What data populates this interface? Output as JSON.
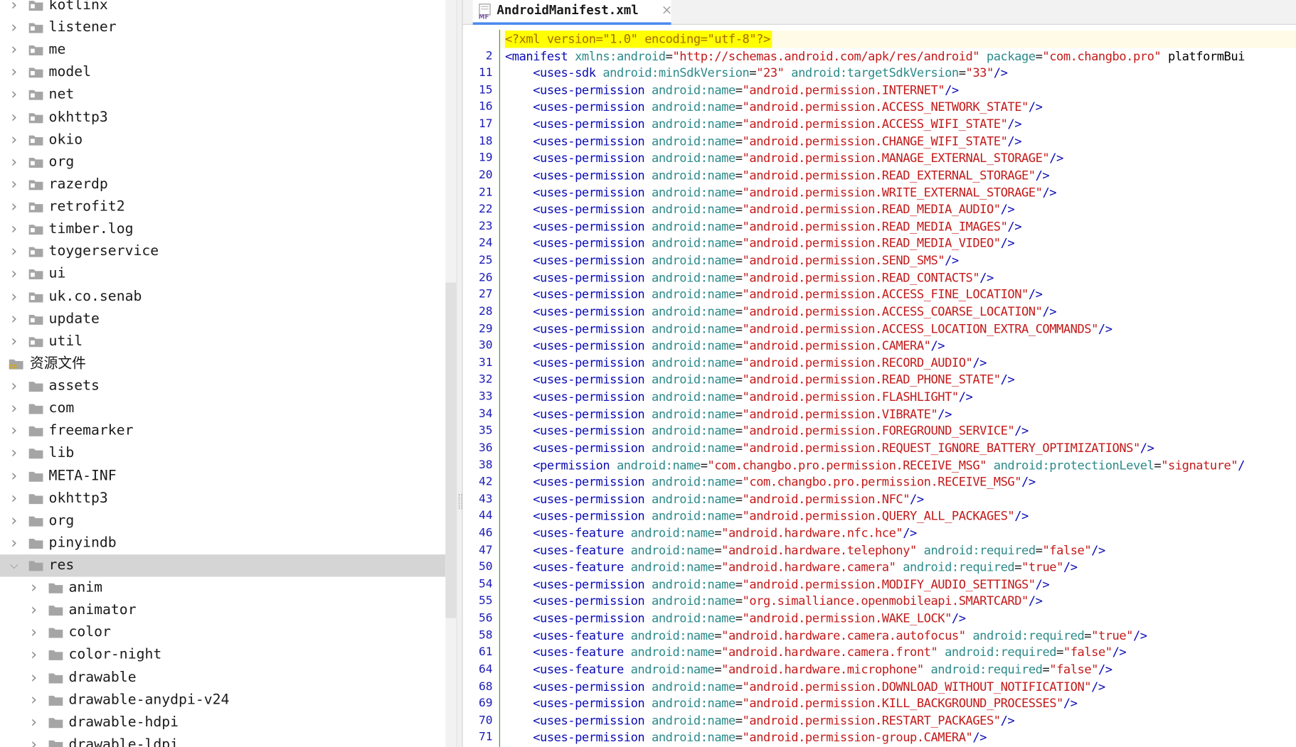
{
  "project_tree": {
    "rows": [
      {
        "label": "kotlinx",
        "indent": 0,
        "chevron": ">",
        "icon": "package-folder-icon"
      },
      {
        "label": "listener",
        "indent": 0,
        "chevron": ">",
        "icon": "package-folder-icon"
      },
      {
        "label": "me",
        "indent": 0,
        "chevron": ">",
        "icon": "package-folder-icon"
      },
      {
        "label": "model",
        "indent": 0,
        "chevron": ">",
        "icon": "package-folder-icon"
      },
      {
        "label": "net",
        "indent": 0,
        "chevron": ">",
        "icon": "package-folder-icon"
      },
      {
        "label": "okhttp3",
        "indent": 0,
        "chevron": ">",
        "icon": "package-folder-icon"
      },
      {
        "label": "okio",
        "indent": 0,
        "chevron": ">",
        "icon": "package-folder-icon"
      },
      {
        "label": "org",
        "indent": 0,
        "chevron": ">",
        "icon": "package-folder-icon"
      },
      {
        "label": "razerdp",
        "indent": 0,
        "chevron": ">",
        "icon": "package-folder-icon"
      },
      {
        "label": "retrofit2",
        "indent": 0,
        "chevron": ">",
        "icon": "package-folder-icon"
      },
      {
        "label": "timber.log",
        "indent": 0,
        "chevron": ">",
        "icon": "package-folder-icon"
      },
      {
        "label": "toygerservice",
        "indent": 0,
        "chevron": ">",
        "icon": "package-folder-icon"
      },
      {
        "label": "ui",
        "indent": 0,
        "chevron": ">",
        "icon": "package-folder-icon"
      },
      {
        "label": "uk.co.senab",
        "indent": 0,
        "chevron": ">",
        "icon": "package-folder-icon"
      },
      {
        "label": "update",
        "indent": 0,
        "chevron": ">",
        "icon": "package-folder-icon"
      },
      {
        "label": "util",
        "indent": 0,
        "chevron": ">",
        "icon": "package-folder-icon"
      },
      {
        "label": "资源文件",
        "indent": -1,
        "chevron": "",
        "icon": "resources-root-icon"
      },
      {
        "label": "assets",
        "indent": 0,
        "chevron": ">",
        "icon": "folder-icon"
      },
      {
        "label": "com",
        "indent": 0,
        "chevron": ">",
        "icon": "folder-icon"
      },
      {
        "label": "freemarker",
        "indent": 0,
        "chevron": ">",
        "icon": "folder-icon"
      },
      {
        "label": "lib",
        "indent": 0,
        "chevron": ">",
        "icon": "folder-icon"
      },
      {
        "label": "META-INF",
        "indent": 0,
        "chevron": ">",
        "icon": "folder-icon"
      },
      {
        "label": "okhttp3",
        "indent": 0,
        "chevron": ">",
        "icon": "folder-icon"
      },
      {
        "label": "org",
        "indent": 0,
        "chevron": ">",
        "icon": "folder-icon"
      },
      {
        "label": "pinyindb",
        "indent": 0,
        "chevron": ">",
        "icon": "folder-icon"
      },
      {
        "label": "res",
        "indent": 0,
        "chevron": "v",
        "icon": "folder-icon",
        "selected": true
      },
      {
        "label": "anim",
        "indent": 1,
        "chevron": ">",
        "icon": "folder-icon"
      },
      {
        "label": "animator",
        "indent": 1,
        "chevron": ">",
        "icon": "folder-icon"
      },
      {
        "label": "color",
        "indent": 1,
        "chevron": ">",
        "icon": "folder-icon"
      },
      {
        "label": "color-night",
        "indent": 1,
        "chevron": ">",
        "icon": "folder-icon"
      },
      {
        "label": "drawable",
        "indent": 1,
        "chevron": ">",
        "icon": "folder-icon"
      },
      {
        "label": "drawable-anydpi-v24",
        "indent": 1,
        "chevron": ">",
        "icon": "folder-icon"
      },
      {
        "label": "drawable-hdpi",
        "indent": 1,
        "chevron": ">",
        "icon": "folder-icon"
      },
      {
        "label": "drawable-ldpi",
        "indent": 1,
        "chevron": ">",
        "icon": "folder-icon"
      }
    ]
  },
  "editor": {
    "tab": {
      "label": "AndroidManifest.xml",
      "close": "×",
      "icon": "manifest-file-icon",
      "icon_text": "MF"
    },
    "colors": {
      "tag": "#0a0ab4",
      "attr": "#2c8a8a",
      "string": "#c41a1a",
      "line_number": "#1c1cb8",
      "highlight": "#ffff00"
    },
    "lines": [
      {
        "num": "",
        "text": "<?xml version=\"1.0\" encoding=\"utf-8\"?>"
      },
      {
        "num": "2",
        "text": "<manifest xmlns:android=\"http://schemas.android.com/apk/res/android\" package=\"com.changbo.pro\" platformBui"
      },
      {
        "num": "11",
        "text": "    <uses-sdk android:minSdkVersion=\"23\" android:targetSdkVersion=\"33\"/>"
      },
      {
        "num": "15",
        "text": "    <uses-permission android:name=\"android.permission.INTERNET\"/>"
      },
      {
        "num": "16",
        "text": "    <uses-permission android:name=\"android.permission.ACCESS_NETWORK_STATE\"/>"
      },
      {
        "num": "17",
        "text": "    <uses-permission android:name=\"android.permission.ACCESS_WIFI_STATE\"/>"
      },
      {
        "num": "18",
        "text": "    <uses-permission android:name=\"android.permission.CHANGE_WIFI_STATE\"/>"
      },
      {
        "num": "19",
        "text": "    <uses-permission android:name=\"android.permission.MANAGE_EXTERNAL_STORAGE\"/>"
      },
      {
        "num": "20",
        "text": "    <uses-permission android:name=\"android.permission.READ_EXTERNAL_STORAGE\"/>"
      },
      {
        "num": "21",
        "text": "    <uses-permission android:name=\"android.permission.WRITE_EXTERNAL_STORAGE\"/>"
      },
      {
        "num": "22",
        "text": "    <uses-permission android:name=\"android.permission.READ_MEDIA_AUDIO\"/>"
      },
      {
        "num": "23",
        "text": "    <uses-permission android:name=\"android.permission.READ_MEDIA_IMAGES\"/>"
      },
      {
        "num": "24",
        "text": "    <uses-permission android:name=\"android.permission.READ_MEDIA_VIDEO\"/>"
      },
      {
        "num": "25",
        "text": "    <uses-permission android:name=\"android.permission.SEND_SMS\"/>"
      },
      {
        "num": "26",
        "text": "    <uses-permission android:name=\"android.permission.READ_CONTACTS\"/>"
      },
      {
        "num": "27",
        "text": "    <uses-permission android:name=\"android.permission.ACCESS_FINE_LOCATION\"/>"
      },
      {
        "num": "28",
        "text": "    <uses-permission android:name=\"android.permission.ACCESS_COARSE_LOCATION\"/>"
      },
      {
        "num": "29",
        "text": "    <uses-permission android:name=\"android.permission.ACCESS_LOCATION_EXTRA_COMMANDS\"/>"
      },
      {
        "num": "30",
        "text": "    <uses-permission android:name=\"android.permission.CAMERA\"/>"
      },
      {
        "num": "31",
        "text": "    <uses-permission android:name=\"android.permission.RECORD_AUDIO\"/>"
      },
      {
        "num": "32",
        "text": "    <uses-permission android:name=\"android.permission.READ_PHONE_STATE\"/>"
      },
      {
        "num": "33",
        "text": "    <uses-permission android:name=\"android.permission.FLASHLIGHT\"/>"
      },
      {
        "num": "34",
        "text": "    <uses-permission android:name=\"android.permission.VIBRATE\"/>"
      },
      {
        "num": "35",
        "text": "    <uses-permission android:name=\"android.permission.FOREGROUND_SERVICE\"/>"
      },
      {
        "num": "36",
        "text": "    <uses-permission android:name=\"android.permission.REQUEST_IGNORE_BATTERY_OPTIMIZATIONS\"/>"
      },
      {
        "num": "38",
        "text": "    <permission android:name=\"com.changbo.pro.permission.RECEIVE_MSG\" android:protectionLevel=\"signature\"/"
      },
      {
        "num": "42",
        "text": "    <uses-permission android:name=\"com.changbo.pro.permission.RECEIVE_MSG\"/>"
      },
      {
        "num": "43",
        "text": "    <uses-permission android:name=\"android.permission.NFC\"/>"
      },
      {
        "num": "44",
        "text": "    <uses-permission android:name=\"android.permission.QUERY_ALL_PACKAGES\"/>"
      },
      {
        "num": "46",
        "text": "    <uses-feature android:name=\"android.hardware.nfc.hce\"/>"
      },
      {
        "num": "47",
        "text": "    <uses-feature android:name=\"android.hardware.telephony\" android:required=\"false\"/>"
      },
      {
        "num": "50",
        "text": "    <uses-feature android:name=\"android.hardware.camera\" android:required=\"true\"/>"
      },
      {
        "num": "54",
        "text": "    <uses-permission android:name=\"android.permission.MODIFY_AUDIO_SETTINGS\"/>"
      },
      {
        "num": "55",
        "text": "    <uses-permission android:name=\"org.simalliance.openmobileapi.SMARTCARD\"/>"
      },
      {
        "num": "56",
        "text": "    <uses-permission android:name=\"android.permission.WAKE_LOCK\"/>"
      },
      {
        "num": "58",
        "text": "    <uses-feature android:name=\"android.hardware.camera.autofocus\" android:required=\"true\"/>"
      },
      {
        "num": "61",
        "text": "    <uses-feature android:name=\"android.hardware.camera.front\" android:required=\"false\"/>"
      },
      {
        "num": "64",
        "text": "    <uses-feature android:name=\"android.hardware.microphone\" android:required=\"false\"/>"
      },
      {
        "num": "68",
        "text": "    <uses-permission android:name=\"android.permission.DOWNLOAD_WITHOUT_NOTIFICATION\"/>"
      },
      {
        "num": "69",
        "text": "    <uses-permission android:name=\"android.permission.KILL_BACKGROUND_PROCESSES\"/>"
      },
      {
        "num": "70",
        "text": "    <uses-permission android:name=\"android.permission.RESTART_PACKAGES\"/>"
      },
      {
        "num": "71",
        "text": "    <uses-permission android:name=\"android.permission-group.CAMERA\"/>"
      }
    ]
  }
}
